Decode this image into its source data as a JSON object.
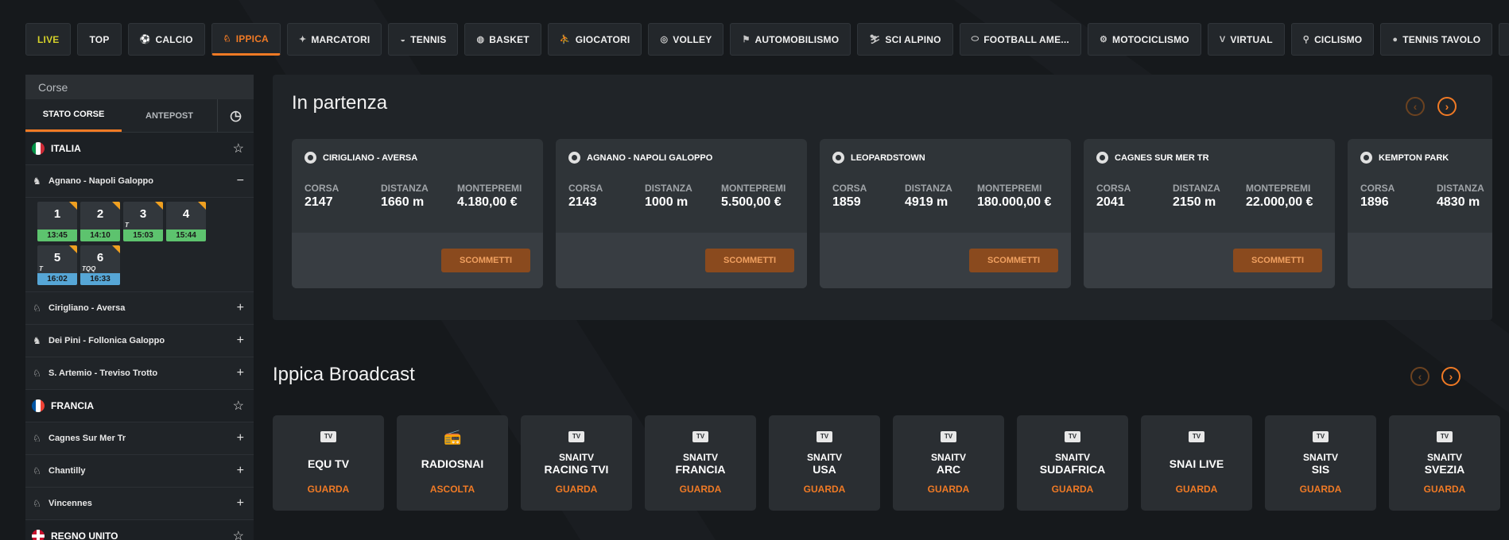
{
  "nav": {
    "items": [
      {
        "label": "LIVE",
        "icon": "",
        "state": "live"
      },
      {
        "label": "TOP",
        "icon": "",
        "state": ""
      },
      {
        "label": "CALCIO",
        "icon": "⚽",
        "state": ""
      },
      {
        "label": "IPPICA",
        "icon": "♘",
        "state": "active"
      },
      {
        "label": "MARCATORI",
        "icon": "✦",
        "state": ""
      },
      {
        "label": "TENNIS",
        "icon": "◒",
        "state": ""
      },
      {
        "label": "BASKET",
        "icon": "◍",
        "state": ""
      },
      {
        "label": "GIOCATORI",
        "icon": "⛹",
        "state": ""
      },
      {
        "label": "VOLLEY",
        "icon": "◎",
        "state": ""
      },
      {
        "label": "AUTOMOBILISMO",
        "icon": "⚑",
        "state": ""
      },
      {
        "label": "SCI ALPINO",
        "icon": "⛷",
        "state": ""
      },
      {
        "label": "FOOTBALL AME...",
        "icon": "⬭",
        "state": ""
      },
      {
        "label": "MOTOCICLISMO",
        "icon": "⚙",
        "state": ""
      },
      {
        "label": "VIRTUAL",
        "icon": "V",
        "state": ""
      },
      {
        "label": "CICLISMO",
        "icon": "⚲",
        "state": ""
      },
      {
        "label": "TENNIS TAVOLO",
        "icon": "●",
        "state": ""
      }
    ]
  },
  "sidebar": {
    "title": "Corse",
    "tab_stato": "STATO CORSE",
    "tab_antepost": "ANTEPOST",
    "clock_icon": "◷",
    "star_icon": "☆",
    "expanded_icon": "−",
    "collapsed_icon": "+",
    "countries": [
      {
        "name": "ITALIA",
        "tracks": [
          "Agnano - Napoli Galoppo",
          "Cirigliano - Aversa",
          "Dei Pini - Follonica Galoppo",
          "S. Artemio - Treviso Trotto"
        ]
      },
      {
        "name": "FRANCIA",
        "tracks": [
          "Cagnes Sur Mer Tr",
          "Chantilly",
          "Vincennes"
        ]
      },
      {
        "name": "REGNO UNITO",
        "tracks": []
      }
    ],
    "races": [
      {
        "num": "1",
        "time": "13:45",
        "color": "green",
        "tag": ""
      },
      {
        "num": "2",
        "time": "14:10",
        "color": "green",
        "tag": ""
      },
      {
        "num": "3",
        "time": "15:03",
        "color": "green",
        "tag": "T"
      },
      {
        "num": "4",
        "time": "15:44",
        "color": "green",
        "tag": ""
      },
      {
        "num": "5",
        "time": "16:02",
        "color": "blue",
        "tag": "T"
      },
      {
        "num": "6",
        "time": "16:33",
        "color": "blue",
        "tag": "TQQ"
      }
    ]
  },
  "partenza": {
    "title": "In partenza",
    "prev_icon": "‹",
    "next_icon": "›",
    "label_corsa": "CORSA",
    "label_distanza": "DISTANZA",
    "label_montepremi": "MONTEPREMI",
    "button_label": "SCOMMETTI",
    "cards": [
      {
        "venue": "CIRIGLIANO - AVERSA",
        "corsa": "2147",
        "distanza": "1660 m",
        "montepremi": "4.180,00 €"
      },
      {
        "venue": "AGNANO - NAPOLI GALOPPO",
        "corsa": "2143",
        "distanza": "1000 m",
        "montepremi": "5.500,00 €"
      },
      {
        "venue": "LEOPARDSTOWN",
        "corsa": "1859",
        "distanza": "4919 m",
        "montepremi": "180.000,00 €"
      },
      {
        "venue": "CAGNES SUR MER TR",
        "corsa": "2041",
        "distanza": "2150 m",
        "montepremi": "22.000,00 €"
      },
      {
        "venue": "KEMPTON PARK",
        "corsa": "1896",
        "distanza": "4830 m",
        "montepremi": ""
      }
    ]
  },
  "broadcast": {
    "title": "Ippica Broadcast",
    "prev_icon": "‹",
    "next_icon": "›",
    "tv_badge": "TV",
    "radio_icon": "📻",
    "channels": [
      {
        "line1": "",
        "line2": "EQU TV",
        "action": "GUARDA",
        "type": "tv"
      },
      {
        "line1": "",
        "line2": "RADIOSNAI",
        "action": "ASCOLTA",
        "type": "radio"
      },
      {
        "line1": "SNAITV",
        "line2": "RACING TVI",
        "action": "GUARDA",
        "type": "tv"
      },
      {
        "line1": "SNAITV",
        "line2": "FRANCIA",
        "action": "GUARDA",
        "type": "tv"
      },
      {
        "line1": "SNAITV",
        "line2": "USA",
        "action": "GUARDA",
        "type": "tv"
      },
      {
        "line1": "SNAITV",
        "line2": "ARC",
        "action": "GUARDA",
        "type": "tv"
      },
      {
        "line1": "SNAITV",
        "line2": "SUDAFRICA",
        "action": "GUARDA",
        "type": "tv"
      },
      {
        "line1": "",
        "line2": "SNAI LIVE",
        "action": "GUARDA",
        "type": "tv"
      },
      {
        "line1": "SNAITV",
        "line2": "SIS",
        "action": "GUARDA",
        "type": "tv"
      },
      {
        "line1": "SNAITV",
        "line2": "SVEZIA",
        "action": "GUARDA",
        "type": "tv"
      }
    ]
  },
  "colors": {
    "accent": "#f07a25",
    "live": "#d4d02a",
    "race_green": "#5dc36e",
    "race_blue": "#56a6d6"
  }
}
